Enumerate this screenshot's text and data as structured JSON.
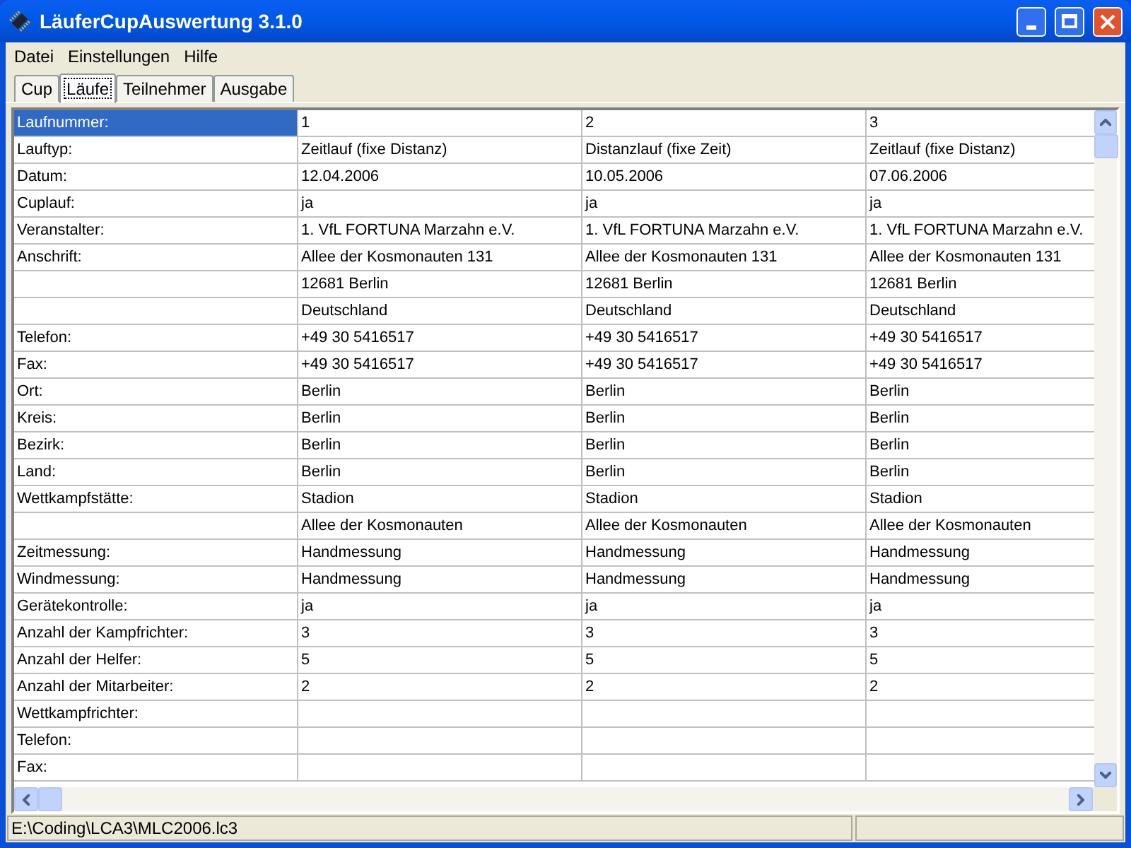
{
  "window": {
    "title": "LäuferCupAuswertung 3.1.0"
  },
  "menu": [
    "Datei",
    "Einstellungen",
    "Hilfe"
  ],
  "tabs": [
    {
      "label": "Cup",
      "selected": false
    },
    {
      "label": "Läufe",
      "selected": true
    },
    {
      "label": "Teilnehmer",
      "selected": false
    },
    {
      "label": "Ausgabe",
      "selected": false
    }
  ],
  "grid": {
    "rows": [
      {
        "label": "Laufnummer:",
        "selected": true,
        "cells": [
          "1",
          "2",
          "3"
        ]
      },
      {
        "label": "Lauftyp:",
        "selected": false,
        "cells": [
          "Zeitlauf (fixe Distanz)",
          "Distanzlauf (fixe Zeit)",
          "Zeitlauf (fixe Distanz)"
        ]
      },
      {
        "label": "Datum:",
        "selected": false,
        "cells": [
          "12.04.2006",
          "10.05.2006",
          "07.06.2006"
        ]
      },
      {
        "label": "Cuplauf:",
        "selected": false,
        "cells": [
          "ja",
          "ja",
          "ja"
        ]
      },
      {
        "label": "Veranstalter:",
        "selected": false,
        "cells": [
          "1. VfL FORTUNA Marzahn e.V.",
          "1. VfL FORTUNA Marzahn e.V.",
          "1. VfL FORTUNA Marzahn e.V."
        ]
      },
      {
        "label": "Anschrift:",
        "selected": false,
        "cells": [
          "Allee der Kosmonauten 131",
          "Allee der Kosmonauten 131",
          "Allee der Kosmonauten 131"
        ]
      },
      {
        "selected": false,
        "cells": [
          "12681 Berlin",
          "12681 Berlin",
          "12681 Berlin"
        ]
      },
      {
        "selected": false,
        "cells": [
          "Deutschland",
          "Deutschland",
          "Deutschland"
        ]
      },
      {
        "label": "Telefon:",
        "selected": false,
        "cells": [
          "+49 30 5416517",
          "+49 30 5416517",
          "+49 30 5416517"
        ]
      },
      {
        "label": "Fax:",
        "selected": false,
        "cells": [
          "+49 30 5416517",
          "+49 30 5416517",
          "+49 30 5416517"
        ]
      },
      {
        "label": "Ort:",
        "selected": false,
        "cells": [
          "Berlin",
          "Berlin",
          "Berlin"
        ]
      },
      {
        "label": "Kreis:",
        "selected": false,
        "cells": [
          "Berlin",
          "Berlin",
          "Berlin"
        ]
      },
      {
        "label": "Bezirk:",
        "selected": false,
        "cells": [
          "Berlin",
          "Berlin",
          "Berlin"
        ]
      },
      {
        "label": "Land:",
        "selected": false,
        "cells": [
          "Berlin",
          "Berlin",
          "Berlin"
        ]
      },
      {
        "label": "Wettkampfstätte:",
        "selected": false,
        "cells": [
          "Stadion",
          "Stadion",
          "Stadion"
        ]
      },
      {
        "selected": false,
        "cells": [
          "Allee der Kosmonauten",
          "Allee der Kosmonauten",
          "Allee der Kosmonauten"
        ]
      },
      {
        "label": "Zeitmessung:",
        "selected": false,
        "cells": [
          "Handmessung",
          "Handmessung",
          "Handmessung"
        ]
      },
      {
        "label": "Windmessung:",
        "selected": false,
        "cells": [
          "Handmessung",
          "Handmessung",
          "Handmessung"
        ]
      },
      {
        "label": "Gerätekontrolle:",
        "selected": false,
        "cells": [
          "ja",
          "ja",
          "ja"
        ]
      },
      {
        "label": "Anzahl der Kampfrichter:",
        "selected": false,
        "cells": [
          "3",
          "3",
          "3"
        ]
      },
      {
        "label": "Anzahl der Helfer:",
        "selected": false,
        "cells": [
          "5",
          "5",
          "5"
        ]
      },
      {
        "label": "Anzahl der Mitarbeiter:",
        "selected": false,
        "cells": [
          "2",
          "2",
          "2"
        ]
      },
      {
        "label": "Wettkampfrichter:",
        "selected": false
      },
      {
        "label": "Telefon:",
        "selected": false
      },
      {
        "label": "Fax:",
        "selected": false
      }
    ]
  },
  "status_bar": {
    "path": "E:\\Coding\\LCA3\\MLC2006.lc3"
  }
}
